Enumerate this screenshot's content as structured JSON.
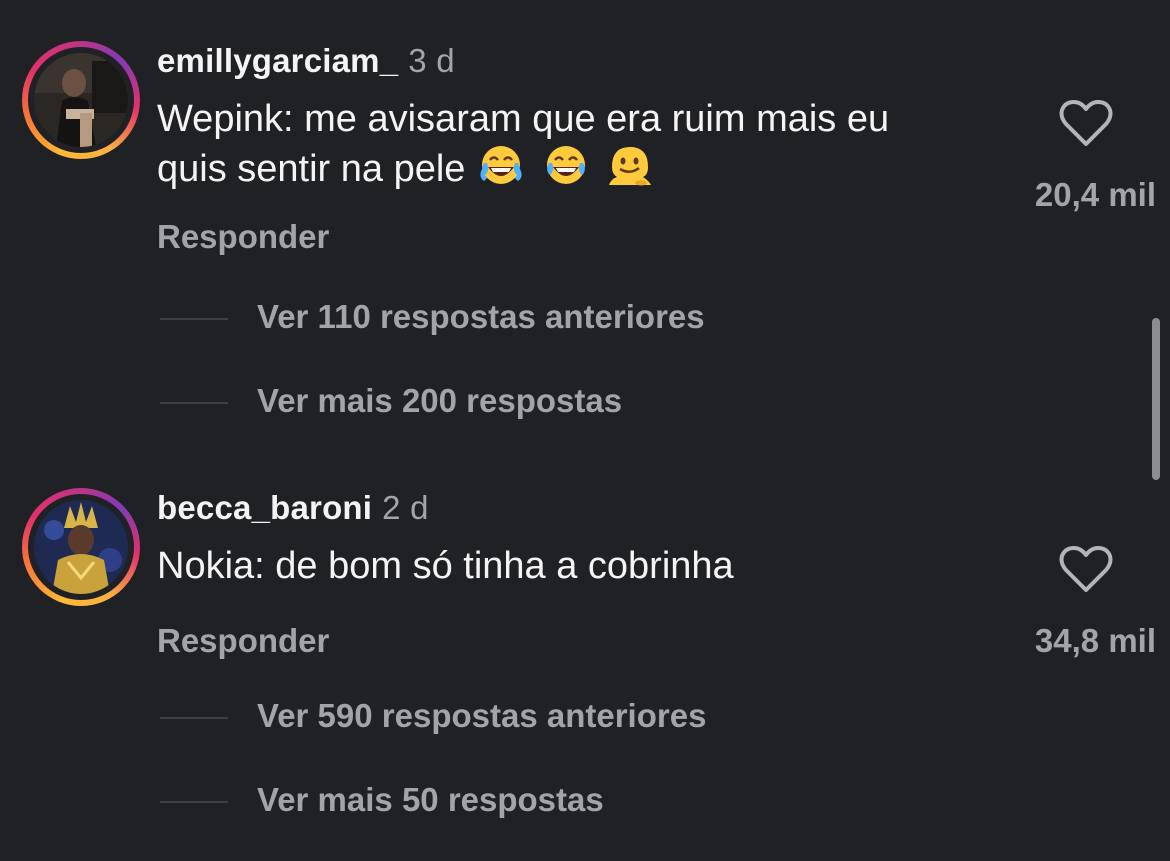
{
  "comments": [
    {
      "username": "emillygarciam_",
      "time": "3 d",
      "text_line1": "Wepink: me avisaram que era ruim mais eu",
      "text_line2": "quis sentir na pele",
      "emojis": [
        "tears-of-joy-emoji",
        "tears-of-joy-emoji",
        "melting-face-emoji"
      ],
      "reply_label": "Responder",
      "likes": "20,4 mil",
      "threads": [
        "Ver 110 respostas anteriores",
        "Ver mais 200 respostas"
      ]
    },
    {
      "username": "becca_baroni",
      "time": "2 d",
      "text_line1": "Nokia: de bom só tinha a cobrinha",
      "reply_label": "Responder",
      "likes": "34,8 mil",
      "threads": [
        "Ver 590 respostas anteriores",
        "Ver mais 50 respostas"
      ]
    }
  ],
  "colors": {
    "background": "#202125",
    "text_primary": "#f4f4f6",
    "text_secondary": "#a3a4a9",
    "story_ring": [
      "#fdb934",
      "#e1306c",
      "#833ab4"
    ]
  },
  "icons": {
    "like": "heart-outline-icon",
    "avatar": "avatar-photo"
  }
}
